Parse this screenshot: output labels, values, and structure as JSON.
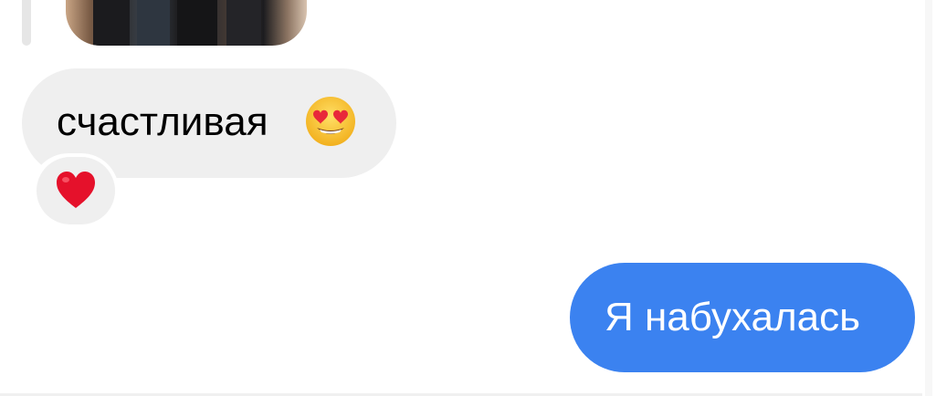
{
  "thread": {
    "incoming": {
      "text": "счастливая",
      "emoji": "smiling-face-with-heart-eyes",
      "reaction": "heart"
    },
    "outgoing": {
      "text": "Я набухалась"
    }
  },
  "colors": {
    "incoming_bubble": "#efefef",
    "outgoing_bubble": "#3b82f0",
    "outgoing_text": "#ffffff",
    "incoming_text": "#000000"
  }
}
